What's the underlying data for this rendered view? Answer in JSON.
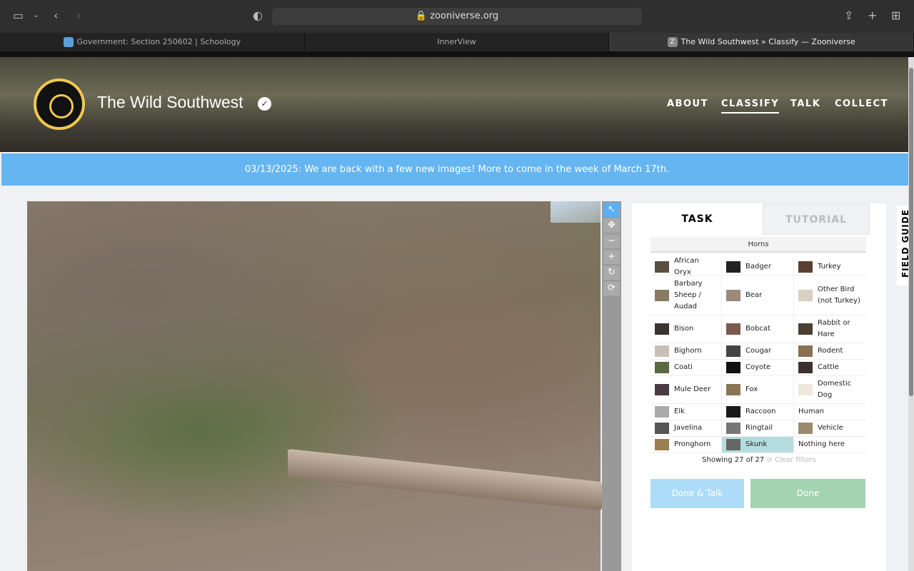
{
  "browser": {
    "url": "zooniverse.org",
    "tabs": [
      {
        "label": "Government: Section 250602 | Schoology",
        "favicon": "S"
      },
      {
        "label": "InnerView",
        "favicon": ""
      },
      {
        "label": "The Wild Southwest » Classify — Zooniverse",
        "favicon": "Z"
      }
    ]
  },
  "header": {
    "title": "The Wild Southwest",
    "nav": [
      "ABOUT",
      "CLASSIFY",
      "TALK",
      "COLLECT"
    ]
  },
  "banner": "03/13/2025: We are back with a few new images! More to come in the week of March 17th.",
  "tools": [
    "↖",
    "✥",
    "−",
    "+",
    "↻",
    "⟳"
  ],
  "panel": {
    "tabs": [
      "TASK",
      "TUTORIAL"
    ],
    "filter": "Horns",
    "choices": [
      [
        "African Oryx",
        "Badger",
        "Turkey"
      ],
      [
        "Barbary Sheep / Audad",
        "Bear",
        "Other Bird (not Turkey)"
      ],
      [
        "Bison",
        "Bobcat",
        "Rabbit or Hare"
      ],
      [
        "Bighorn",
        "Cougar",
        "Rodent"
      ],
      [
        "Coati",
        "Coyote",
        "Cattle"
      ],
      [
        "Mule Deer",
        "Fox",
        "Domestic Dog"
      ],
      [
        "Elk",
        "Raccoon",
        "Human"
      ],
      [
        "Javelina",
        "Ringtail",
        "Vehicle"
      ],
      [
        "Pronghorn",
        "Skunk",
        "Nothing here"
      ]
    ],
    "selected": "Skunk",
    "showing": "Showing 27 of 27",
    "clear": "⊘ Clear filters",
    "done_talk": "Done & Talk",
    "done": "Done"
  },
  "field_guide": "FIELD GUIDE"
}
